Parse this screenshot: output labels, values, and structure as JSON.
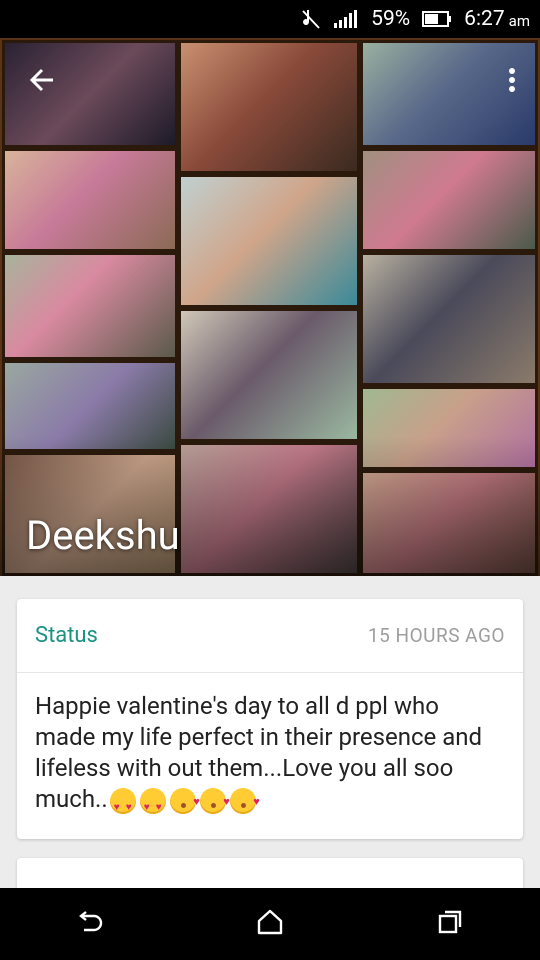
{
  "status_bar": {
    "battery": "59%",
    "time": "6:27",
    "ampm": "am"
  },
  "header": {
    "contact_name": "Deekshu"
  },
  "status_card": {
    "title": "Status",
    "time_ago": "15 HOURS AGO",
    "text": "Happie valentine's day to all d ppl who made my life perfect in their presence and lifeless with out them...Love you all soo much.."
  },
  "icons": {
    "back": "back-arrow-icon",
    "overflow": "more-vert-icon",
    "nav_back": "nav-back-icon",
    "nav_home": "nav-home-icon",
    "nav_recents": "nav-recents-icon"
  },
  "colors": {
    "accent": "#1b9383",
    "header_bg": "#5a3414"
  }
}
